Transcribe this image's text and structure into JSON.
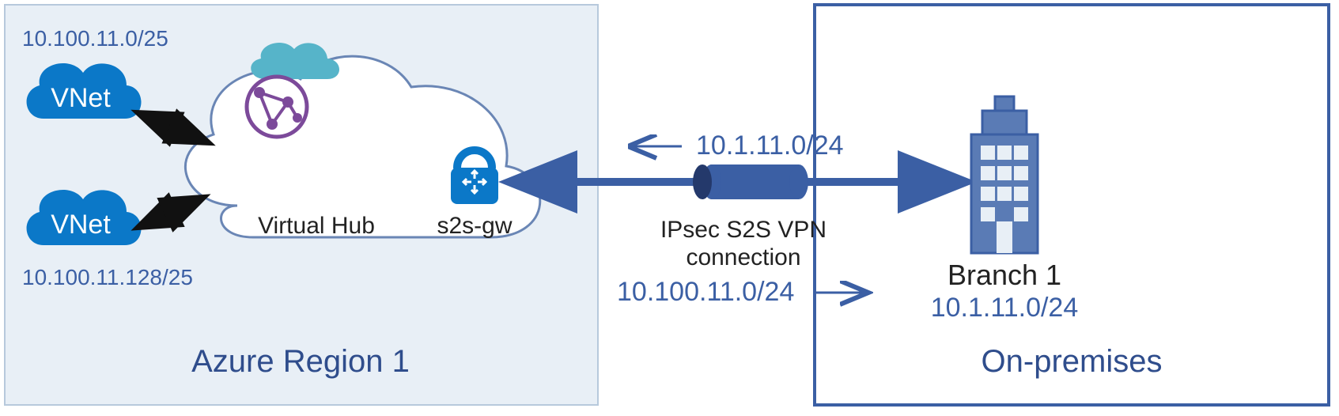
{
  "azure": {
    "region_label": "Azure Region 1",
    "vnet1_cidr": "10.100.11.0/25",
    "vnet2_cidr": "10.100.11.128/25",
    "vnet_label": "VNet",
    "hub_label": "Virtual Hub",
    "gw_label": "s2s-gw"
  },
  "link": {
    "left_cidr": "10.1.11.0/24",
    "type_line1": "IPsec S2S VPN",
    "type_line2": "connection",
    "right_cidr": "10.100.11.0/24"
  },
  "onprem": {
    "box_label": "On-premises",
    "branch_label": "Branch 1",
    "branch_cidr": "10.1.11.0/24"
  }
}
